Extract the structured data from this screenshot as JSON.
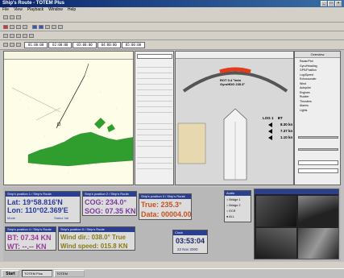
{
  "window": {
    "title": "Ship's Route - TOTEM Plus"
  },
  "menu": {
    "items": [
      "File",
      "View",
      "Playback",
      "Window",
      "Help"
    ]
  },
  "timeline": {
    "cells": [
      "01:00:00",
      "02:00:00",
      "03:00:00",
      "04:00:00",
      "05:00:00"
    ]
  },
  "nav_lat": {
    "title": "Ship's position 1 / Ship's Route",
    "lat_label": "Lat:",
    "lat_value": "19°58.816'N",
    "lon_label": "Lon:",
    "lon_value": "110°02.369'E",
    "mode_label": "Mode",
    "status_label": "Status Val"
  },
  "nav_cog": {
    "title": "Ship's position 2 / Ship's Route",
    "cog": "COG: 234.0°",
    "sog": "SOG: 07.35 KN"
  },
  "nav_true": {
    "title": "Ship's position 3 / Ship's Route",
    "true": "True: 235.3°",
    "data": "Data: 00004.00"
  },
  "nav_bt": {
    "title": "Ship's position 4 / Ship's Route",
    "bt": "BT: 07.34 KN",
    "wt": "WT: --.-- KN"
  },
  "nav_wind": {
    "title": "Ship's position 5 / Ship's Route",
    "wind_dir": "Wind dir.: 038.0° True",
    "wind_speed": "Wind speed: 015.8 KN"
  },
  "clock": {
    "title": "Clock",
    "time": "03:53:04",
    "date": "22 Nov 2000"
  },
  "bridge": {
    "title": "Audio",
    "items": [
      "Bridge 1",
      "Bridge 2",
      "ECR",
      "ALL"
    ]
  },
  "conning": {
    "rot_label": "ROT",
    "rot_value": "0.4 °/min",
    "gyro_label": "GyroHDG",
    "gyro_value": "235.3°",
    "log_label": "LOG 1",
    "bt_label": "BT",
    "speed_1": "8.30 kn",
    "speed_2": "7.37 kn",
    "speed_3": "1.10 kn"
  },
  "right_panel": {
    "title": "Overview",
    "items": [
      "Radar/Plot",
      "Gyro/Heading",
      "GPS/Position",
      "Log/Speed",
      "Echosounder",
      "Wind",
      "Autopilot",
      "Engines",
      "Rudder",
      "Thrusters",
      "Alarms",
      "Lights"
    ]
  },
  "taskbar": {
    "start": "Start",
    "tasks": [
      "TOTEM Plus",
      "TOTEM"
    ]
  },
  "colors": {
    "accent_blue": "#2a3f8f",
    "nav_text": "#2a3a9a",
    "cog_text": "#7a3ca0",
    "true_text": "#c8501e",
    "bt_text": "#9a3a9a",
    "wind_text": "#8a7a10",
    "land_green": "#2f9e2f",
    "rot_bar": "#e23a1a"
  }
}
